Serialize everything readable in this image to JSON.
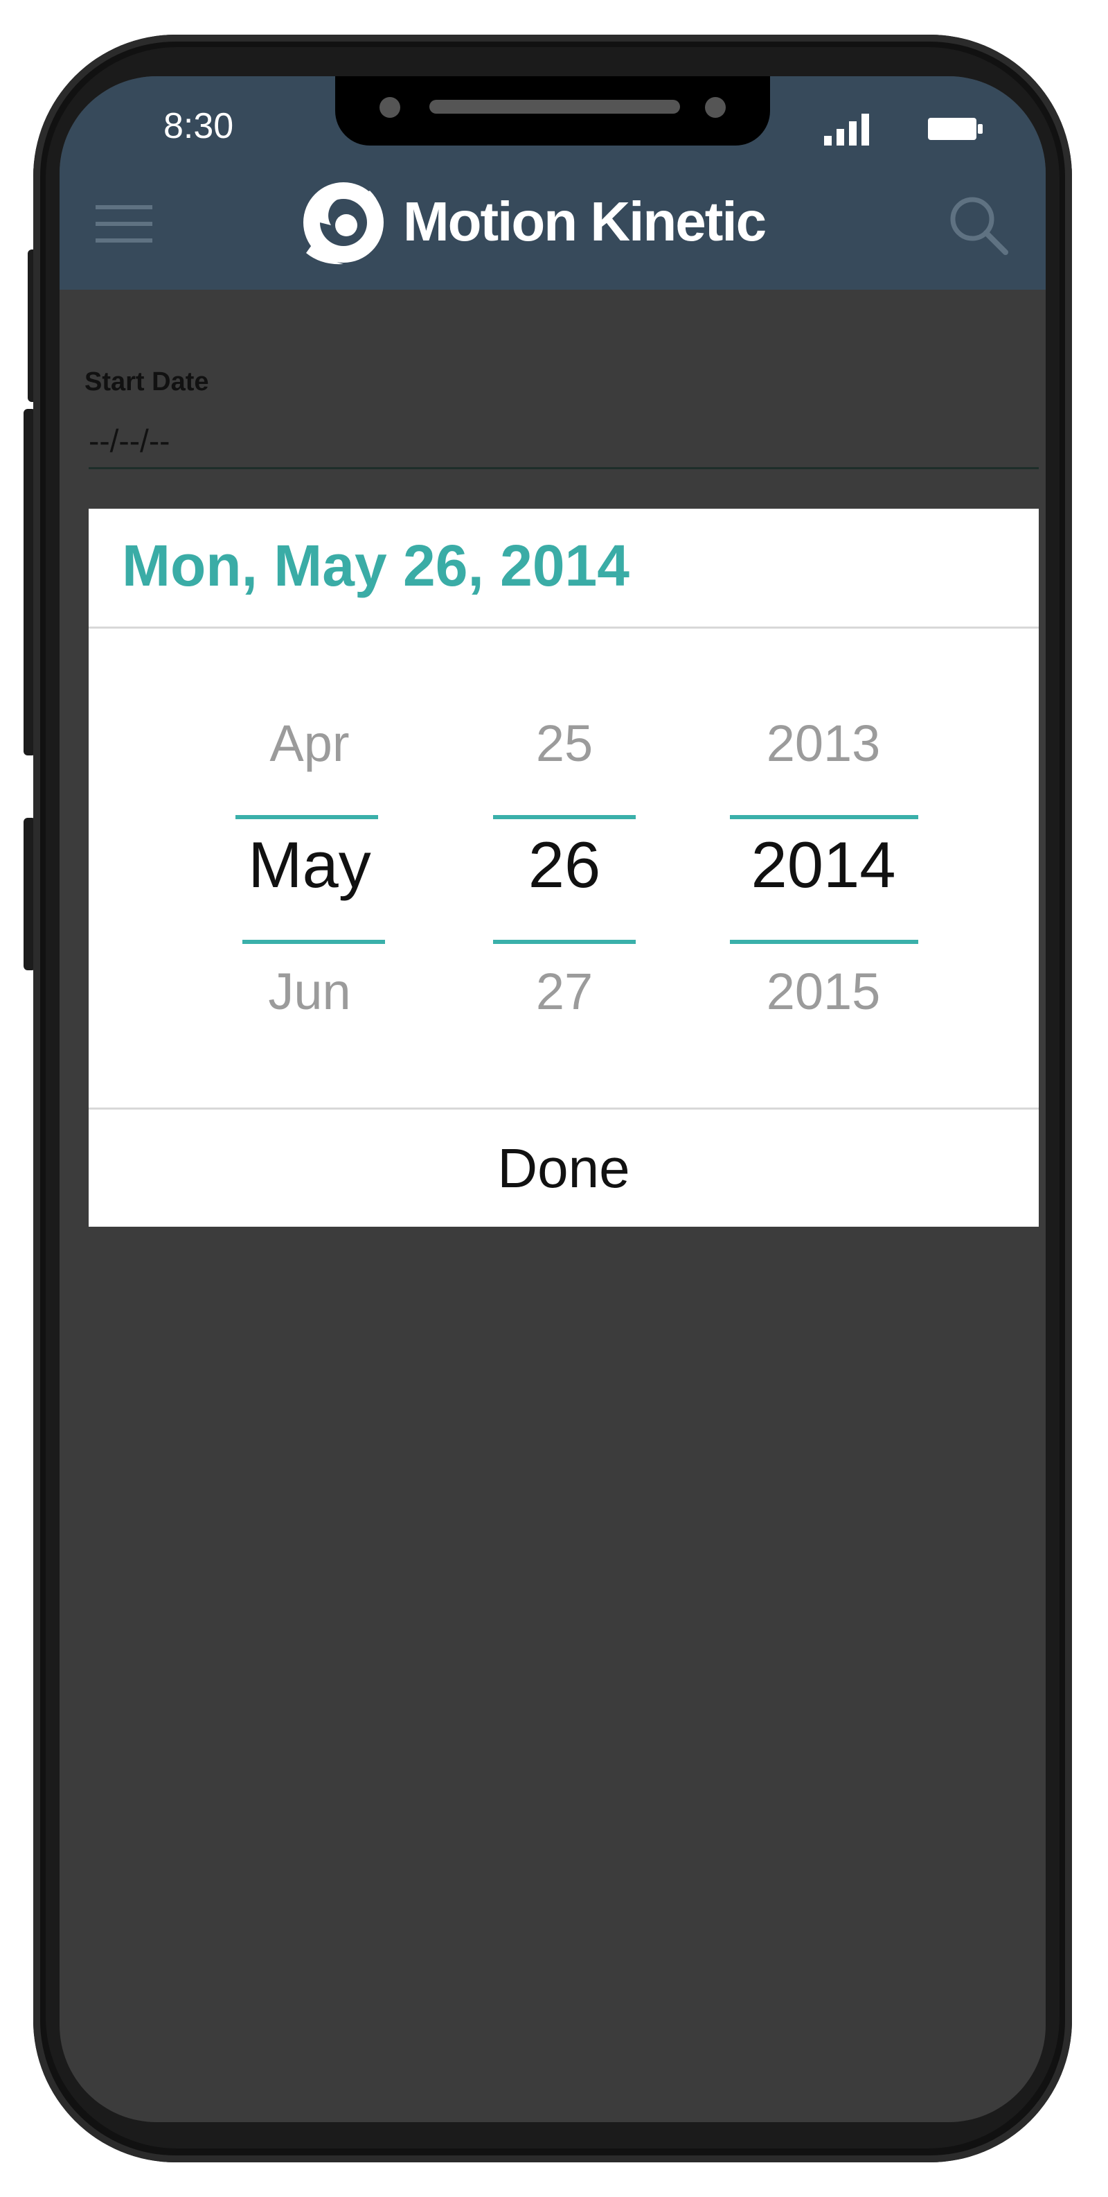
{
  "status_bar": {
    "time": "8:30",
    "signal_icon": "signal-icon",
    "battery_icon": "battery-icon"
  },
  "header": {
    "menu_icon": "hamburger-menu-icon",
    "logo_icon": "swirl-logo-icon",
    "brand": "Motion Kinetic",
    "search_icon": "search-icon",
    "background_color": "#374a5b"
  },
  "form": {
    "start_date_label": "Start Date",
    "start_date_value": "--/--/--"
  },
  "date_picker": {
    "selected_date": "Mon, May 26, 2014",
    "accent_color": "#3ab0aa",
    "month": {
      "prev": "Apr",
      "current": "May",
      "next": "Jun"
    },
    "day": {
      "prev": "25",
      "current": "26",
      "next": "27"
    },
    "year": {
      "prev": "2013",
      "current": "2014",
      "next": "2015"
    },
    "done_label": "Done"
  }
}
